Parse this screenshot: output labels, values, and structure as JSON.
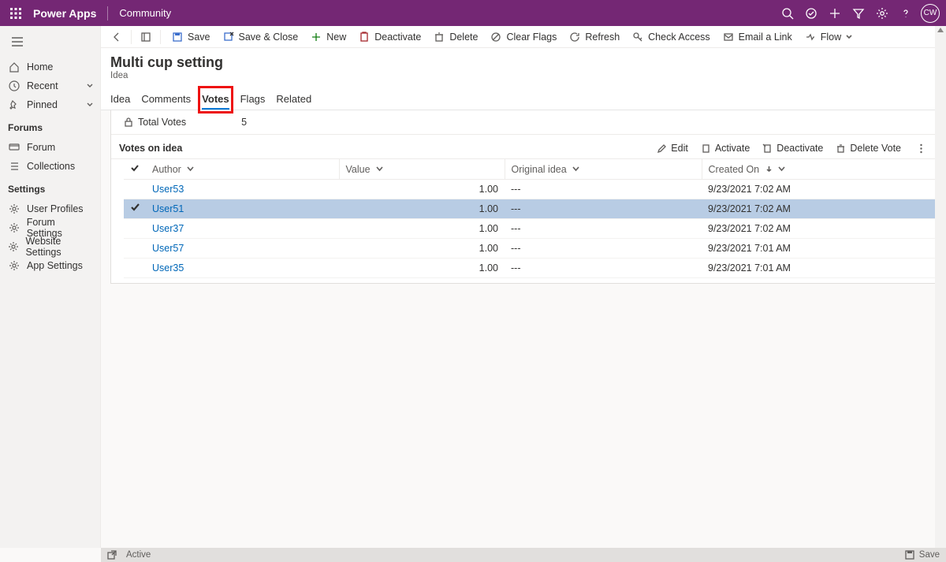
{
  "topbar": {
    "brand": "Power Apps",
    "context": "Community",
    "avatar_initials": "CW"
  },
  "sidebar": {
    "nav": {
      "home": "Home",
      "recent": "Recent",
      "pinned": "Pinned"
    },
    "section_forum": "Forums",
    "forum_items": {
      "forum": "Forum",
      "collections": "Collections"
    },
    "section_settings": "Settings",
    "settings_items": {
      "user_profiles": "User Profiles",
      "forum_settings": "Forum Settings",
      "website_settings": "Website Settings",
      "app_settings": "App Settings"
    }
  },
  "commandbar": {
    "save": "Save",
    "save_close": "Save & Close",
    "new": "New",
    "deactivate": "Deactivate",
    "delete": "Delete",
    "clear_flags": "Clear Flags",
    "refresh": "Refresh",
    "check_access": "Check Access",
    "email_link": "Email a Link",
    "flow": "Flow"
  },
  "page": {
    "title": "Multi cup setting",
    "subtitle": "Idea"
  },
  "tabs": {
    "idea": "Idea",
    "comments": "Comments",
    "votes": "Votes",
    "flags": "Flags",
    "related": "Related"
  },
  "summary": {
    "total_votes_label": "Total Votes",
    "total_votes_value": "5"
  },
  "section": {
    "title": "Votes on idea",
    "actions": {
      "edit": "Edit",
      "activate": "Activate",
      "deactivate": "Deactivate",
      "delete_vote": "Delete Vote"
    }
  },
  "table": {
    "headers": {
      "author": "Author",
      "value": "Value",
      "original_idea": "Original idea",
      "created_on": "Created On"
    },
    "rows": [
      {
        "author": "User53",
        "value": "1.00",
        "original": "---",
        "created": "9/23/2021 7:02 AM",
        "selected": false
      },
      {
        "author": "User51",
        "value": "1.00",
        "original": "---",
        "created": "9/23/2021 7:02 AM",
        "selected": true
      },
      {
        "author": "User37",
        "value": "1.00",
        "original": "---",
        "created": "9/23/2021 7:02 AM",
        "selected": false
      },
      {
        "author": "User57",
        "value": "1.00",
        "original": "---",
        "created": "9/23/2021 7:01 AM",
        "selected": false
      },
      {
        "author": "User35",
        "value": "1.00",
        "original": "---",
        "created": "9/23/2021 7:01 AM",
        "selected": false
      }
    ]
  },
  "statusbar": {
    "status": "Active",
    "save": "Save"
  }
}
